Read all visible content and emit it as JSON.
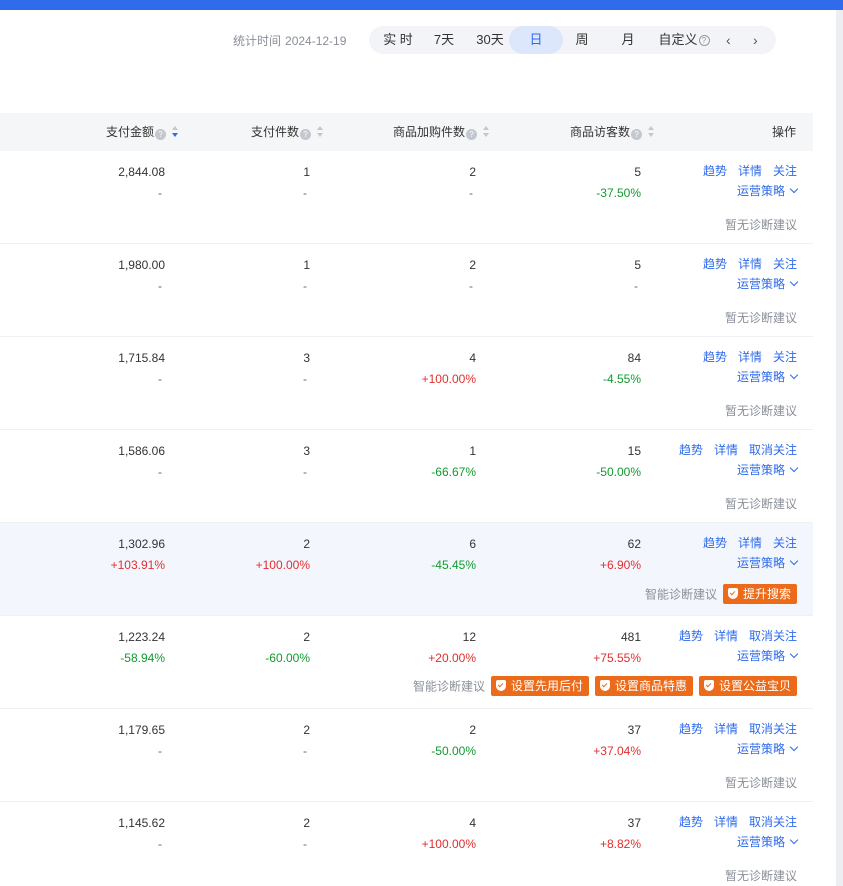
{
  "header": {
    "stat_label": "统计时间",
    "stat_date": "2024-12-19",
    "periods": [
      {
        "label": "实 时",
        "active": false
      },
      {
        "label": "7天",
        "active": false
      },
      {
        "label": "30天",
        "active": false
      },
      {
        "label": "日",
        "active": true
      },
      {
        "label": "周",
        "active": false
      },
      {
        "label": "月",
        "active": false
      },
      {
        "label": "自定义",
        "active": false
      }
    ],
    "prev_icon": "chevron-left-icon",
    "next_icon": "chevron-right-icon"
  },
  "table": {
    "columns": {
      "pay_amount": "支付金额",
      "pay_count": "支付件数",
      "cart_count": "商品加购件数",
      "visitors": "商品访客数",
      "actions": "操作"
    },
    "action_labels": {
      "trend": "趋势",
      "detail": "详情",
      "follow": "关注",
      "unfollow": "取消关注",
      "strategy": "运营策略"
    },
    "no_diag": "暂无诊断建议",
    "smart_diag": "智能诊断建议",
    "rows": [
      {
        "amount": "2,844.08",
        "amount_chg": "-",
        "count": "1",
        "count_chg": "-",
        "cart": "2",
        "cart_chg": "-",
        "visitors": "5",
        "visitors_chg": "-37.50%",
        "followed": false,
        "badges": []
      },
      {
        "amount": "1,980.00",
        "amount_chg": "-",
        "count": "1",
        "count_chg": "-",
        "cart": "2",
        "cart_chg": "-",
        "visitors": "5",
        "visitors_chg": "-",
        "followed": false,
        "badges": []
      },
      {
        "amount": "1,715.84",
        "amount_chg": "-",
        "count": "3",
        "count_chg": "-",
        "cart": "4",
        "cart_chg": "+100.00%",
        "visitors": "84",
        "visitors_chg": "-4.55%",
        "followed": false,
        "badges": []
      },
      {
        "amount": "1,586.06",
        "amount_chg": "-",
        "count": "3",
        "count_chg": "-",
        "cart": "1",
        "cart_chg": "-66.67%",
        "visitors": "15",
        "visitors_chg": "-50.00%",
        "followed": true,
        "badges": []
      },
      {
        "amount": "1,302.96",
        "amount_chg": "+103.91%",
        "count": "2",
        "count_chg": "+100.00%",
        "cart": "6",
        "cart_chg": "-45.45%",
        "visitors": "62",
        "visitors_chg": "+6.90%",
        "followed": false,
        "highlight": true,
        "badges": [
          "提升搜索"
        ]
      },
      {
        "amount": "1,223.24",
        "amount_chg": "-58.94%",
        "count": "2",
        "count_chg": "-60.00%",
        "cart": "12",
        "cart_chg": "+20.00%",
        "visitors": "481",
        "visitors_chg": "+75.55%",
        "followed": true,
        "badges": [
          "设置先用后付",
          "设置商品特惠",
          "设置公益宝贝"
        ]
      },
      {
        "amount": "1,179.65",
        "amount_chg": "-",
        "count": "2",
        "count_chg": "-",
        "cart": "2",
        "cart_chg": "-50.00%",
        "visitors": "37",
        "visitors_chg": "+37.04%",
        "followed": true,
        "badges": []
      },
      {
        "amount": "1,145.62",
        "amount_chg": "-",
        "count": "2",
        "count_chg": "-",
        "cart": "4",
        "cart_chg": "+100.00%",
        "visitors": "37",
        "visitors_chg": "+8.82%",
        "followed": true,
        "badges": []
      }
    ]
  },
  "colors": {
    "accent": "#2f6bea",
    "positive": "#e02f2f",
    "negative": "#129a2e",
    "badge": "#ec6b1a"
  }
}
